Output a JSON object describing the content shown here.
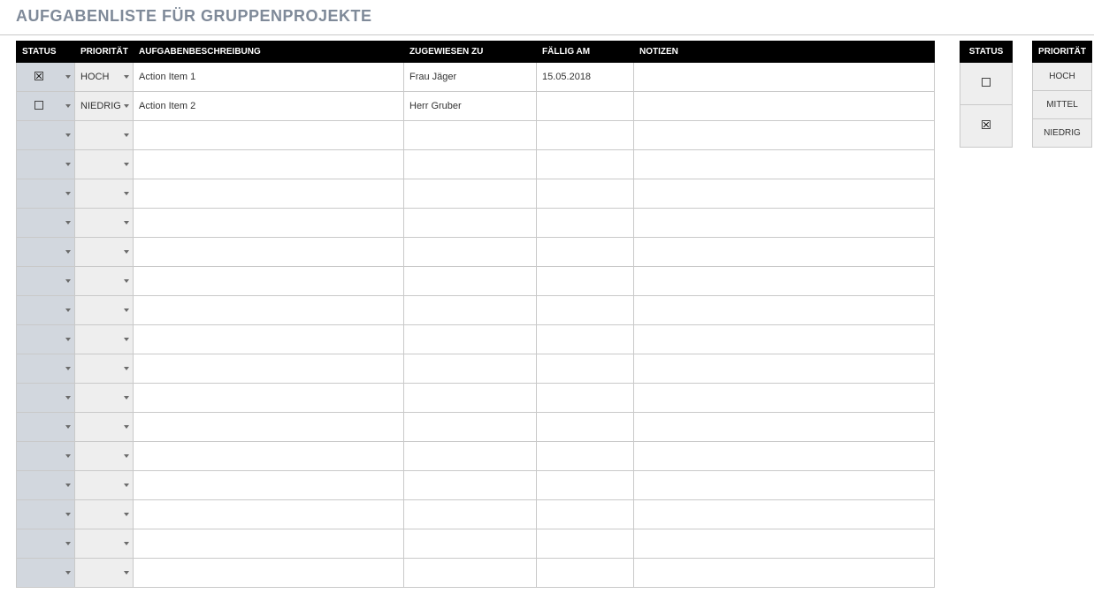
{
  "title": "AUFGABENLISTE FÜR GRUPPENPROJEKTE",
  "columns": {
    "status": "STATUS",
    "priority": "PRIORITÄT",
    "description": "AUFGABENBESCHREIBUNG",
    "assigned": "ZUGEWIESEN ZU",
    "due": "FÄLLIG AM",
    "notes": "NOTIZEN"
  },
  "rows": [
    {
      "status": "checked",
      "priority": "HOCH",
      "description": "Action Item 1",
      "assigned": "Frau Jäger",
      "due": "15.05.2018",
      "notes": ""
    },
    {
      "status": "unchecked",
      "priority": "NIEDRIG",
      "description": "Action Item 2",
      "assigned": "Herr Gruber",
      "due": "",
      "notes": ""
    },
    {
      "status": "",
      "priority": "",
      "description": "",
      "assigned": "",
      "due": "",
      "notes": ""
    },
    {
      "status": "",
      "priority": "",
      "description": "",
      "assigned": "",
      "due": "",
      "notes": ""
    },
    {
      "status": "",
      "priority": "",
      "description": "",
      "assigned": "",
      "due": "",
      "notes": ""
    },
    {
      "status": "",
      "priority": "",
      "description": "",
      "assigned": "",
      "due": "",
      "notes": ""
    },
    {
      "status": "",
      "priority": "",
      "description": "",
      "assigned": "",
      "due": "",
      "notes": ""
    },
    {
      "status": "",
      "priority": "",
      "description": "",
      "assigned": "",
      "due": "",
      "notes": ""
    },
    {
      "status": "",
      "priority": "",
      "description": "",
      "assigned": "",
      "due": "",
      "notes": ""
    },
    {
      "status": "",
      "priority": "",
      "description": "",
      "assigned": "",
      "due": "",
      "notes": ""
    },
    {
      "status": "",
      "priority": "",
      "description": "",
      "assigned": "",
      "due": "",
      "notes": ""
    },
    {
      "status": "",
      "priority": "",
      "description": "",
      "assigned": "",
      "due": "",
      "notes": ""
    },
    {
      "status": "",
      "priority": "",
      "description": "",
      "assigned": "",
      "due": "",
      "notes": ""
    },
    {
      "status": "",
      "priority": "",
      "description": "",
      "assigned": "",
      "due": "",
      "notes": ""
    },
    {
      "status": "",
      "priority": "",
      "description": "",
      "assigned": "",
      "due": "",
      "notes": ""
    },
    {
      "status": "",
      "priority": "",
      "description": "",
      "assigned": "",
      "due": "",
      "notes": ""
    },
    {
      "status": "",
      "priority": "",
      "description": "",
      "assigned": "",
      "due": "",
      "notes": ""
    },
    {
      "status": "",
      "priority": "",
      "description": "",
      "assigned": "",
      "due": "",
      "notes": ""
    }
  ],
  "legend": {
    "status": {
      "header": "STATUS",
      "items": [
        "unchecked",
        "checked"
      ]
    },
    "priority": {
      "header": "PRIORITÄT",
      "items": [
        "HOCH",
        "MITTEL",
        "NIEDRIG"
      ]
    }
  }
}
